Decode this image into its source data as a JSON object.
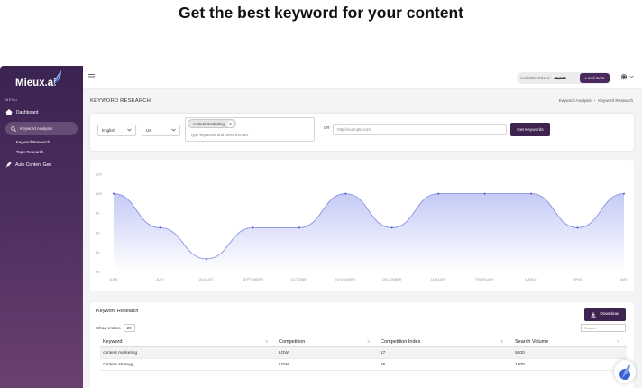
{
  "headline": "Get the best keyword for your content",
  "sidebar": {
    "logo": "Mieux.ai",
    "menu_label": "MENU",
    "items": [
      {
        "label": "Dashboard",
        "icon": "home-icon"
      },
      {
        "label": "Keyword Analysis",
        "icon": "search-icon"
      },
      {
        "label": "Keyword Research"
      },
      {
        "label": "Topic Research"
      },
      {
        "label": "Auto Content Gen",
        "icon": "rocket-icon"
      }
    ]
  },
  "topbar": {
    "tokens_label": "Available Tokens :",
    "tokens_value": "45,544",
    "add_more": "+ Add more"
  },
  "page": {
    "title": "KEYWORD RESEARCH",
    "breadcrumb": [
      "Keyword Analysis",
      "Keyword Research"
    ]
  },
  "search": {
    "language": "English",
    "country": "UK",
    "chip": "content marketing",
    "chip_close": "×",
    "keywords_placeholder": "Type keywords and press ENTER",
    "or": "OR",
    "url_placeholder": "http://example.com",
    "button": "Get Keywords"
  },
  "chart_data": {
    "type": "area",
    "categories": [
      "JUNE",
      "JULY",
      "AUGUST",
      "SEPTEMBER",
      "OCTOBER",
      "NOVEMBER",
      "DECEMBER",
      "JANUARY",
      "FEBRUARY",
      "MARCH",
      "APRIL",
      "MAY"
    ],
    "y_ticks": [
      "12K",
      "10K",
      "8K",
      "6K",
      "4K",
      "2K"
    ],
    "values": [
      10000,
      6500,
      3300,
      6500,
      6500,
      10000,
      6500,
      10000,
      10000,
      10000,
      6500,
      10000
    ],
    "ylim": [
      2000,
      12000
    ],
    "grid": false,
    "colors": {
      "line": "#8a93e6",
      "fill_top": "#c5cbf6",
      "fill_bottom": "#ffffff"
    }
  },
  "table": {
    "title": "Keyword Research",
    "download": "Download",
    "show_entries_label": "Show entries",
    "entries": "20",
    "search_placeholder": "Search",
    "columns": [
      "Keyword",
      "Competition",
      "Competition Index",
      "Search Volume"
    ],
    "rows": [
      [
        "content marketing",
        "LOW",
        "17",
        "5400"
      ],
      [
        "content strategy",
        "LOW",
        "25",
        "1900"
      ]
    ]
  },
  "colors": {
    "brand": "#3d2450",
    "sidebar_top": "#3a2350"
  }
}
